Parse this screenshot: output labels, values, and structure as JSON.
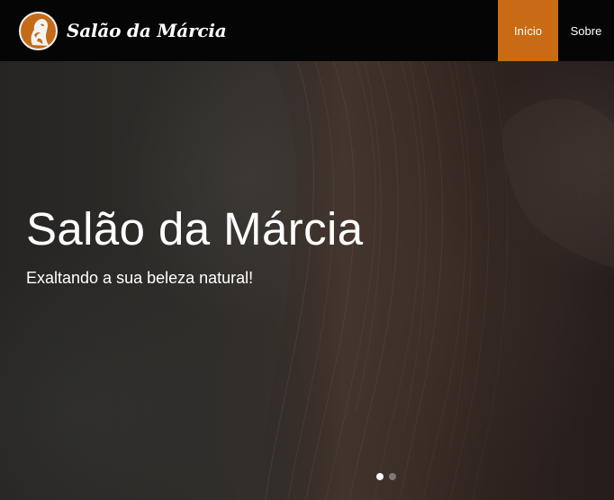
{
  "navbar": {
    "brand_name": "Salão da Márcia",
    "logo_icon": "woman-profile-logo-icon",
    "links": [
      {
        "label": "Início",
        "active": true
      },
      {
        "label": "Sobre",
        "active": false
      }
    ],
    "accent_color": "#c96a14",
    "background_color": "#050505"
  },
  "hero": {
    "title": "Salão da Márcia",
    "subtitle": "Exaltando a sua beleza natural!",
    "image_description_icon": "woman-hair-background-image",
    "carousel": {
      "slides": 2,
      "active_index": 0
    }
  }
}
